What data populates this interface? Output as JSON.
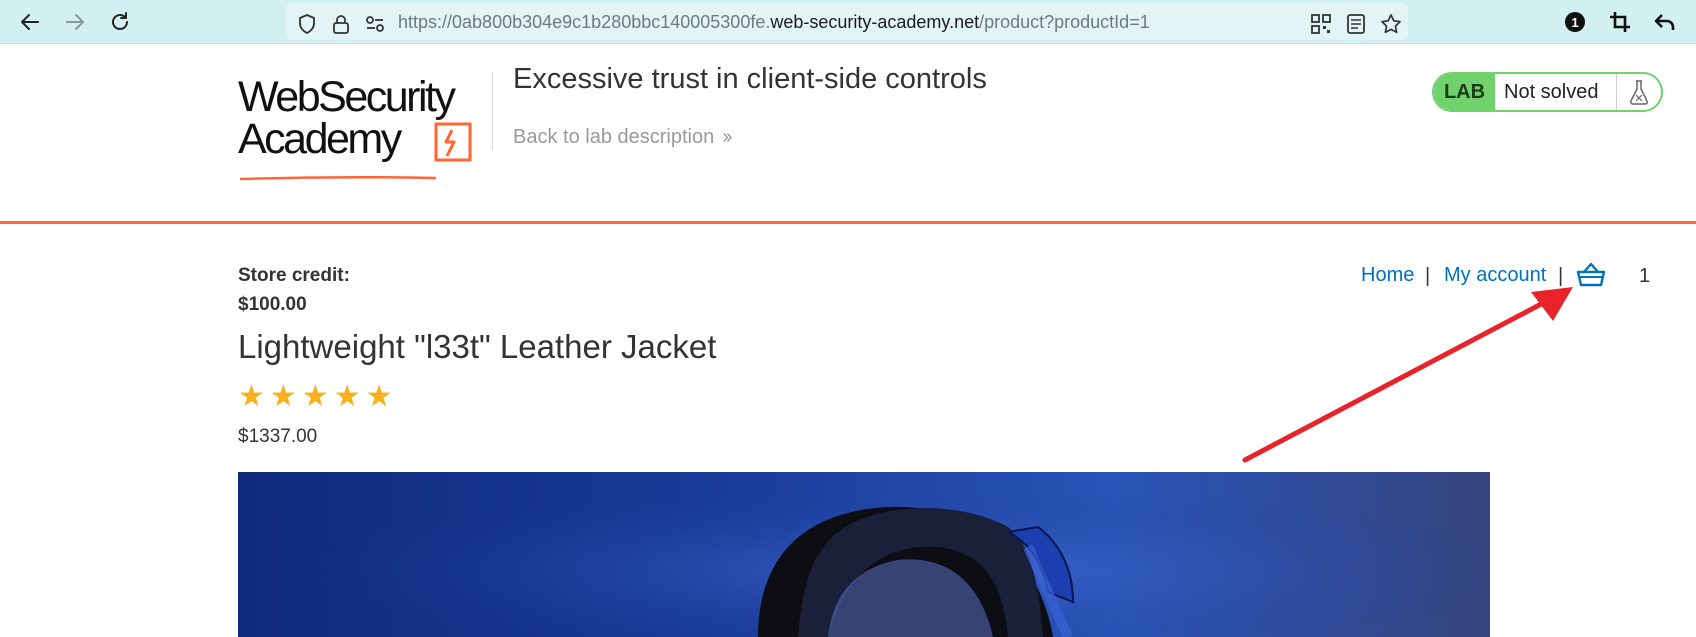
{
  "browser": {
    "url_prefix": "https://0ab800b304e9c1b280bbc140005300fe.",
    "url_domain": "web-security-academy.net",
    "url_path": "/product?productId=1",
    "extension_badge": "1"
  },
  "header": {
    "logo_line1": "WebSecurity",
    "logo_line2": "Academy",
    "lab_title": "Excessive trust in client-side controls",
    "back_link": "Back to lab description",
    "lab_badge": "LAB",
    "lab_status": "Not solved"
  },
  "account": {
    "credit_label": "Store credit:",
    "credit_value": "$100.00"
  },
  "nav": {
    "home": "Home",
    "my_account": "My account",
    "separator": "|",
    "cart_count": "1"
  },
  "product": {
    "title": "Lightweight \"l33t\" Leather Jacket",
    "rating": 5,
    "price": "$1337.00"
  },
  "colors": {
    "accent": "#ff6633",
    "link": "#0071bc",
    "lab_green": "#70d16d",
    "star": "#f7b11a",
    "annotation_arrow": "#e8232a"
  }
}
